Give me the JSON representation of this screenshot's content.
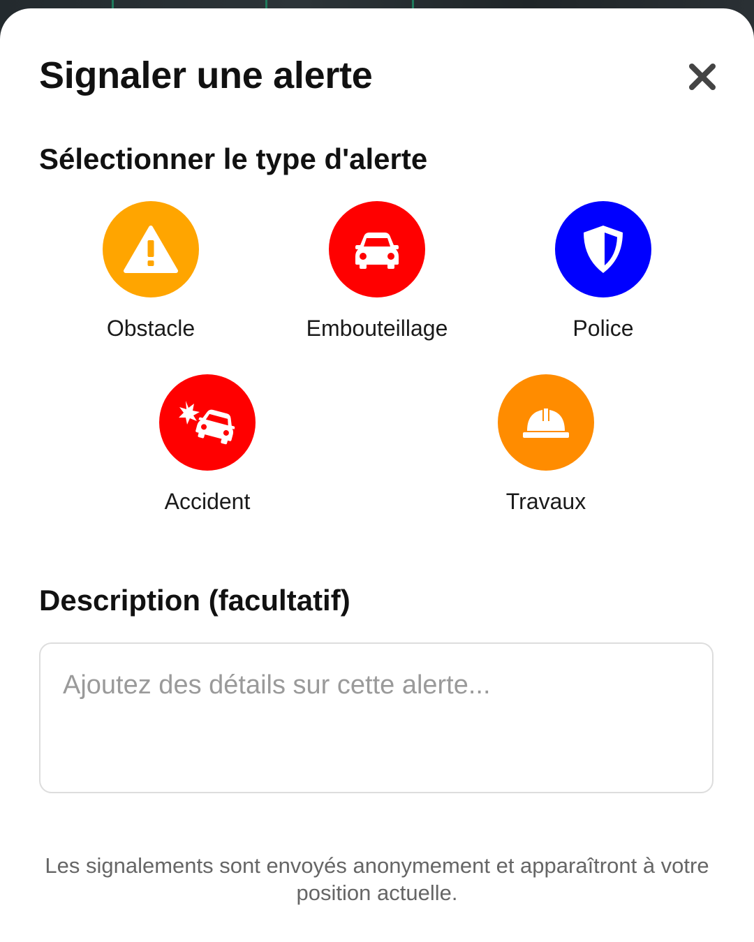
{
  "dialog": {
    "title": "Signaler une alerte",
    "close_icon": "close-icon"
  },
  "alert_types": {
    "heading": "Sélectionner le type d'alerte",
    "options": [
      {
        "label": "Obstacle",
        "icon": "warning-triangle-icon",
        "color": "#FFA500"
      },
      {
        "label": "Embouteillage",
        "icon": "car-icon",
        "color": "#FF0000"
      },
      {
        "label": "Police",
        "icon": "shield-icon",
        "color": "#0000FF"
      },
      {
        "label": "Accident",
        "icon": "car-crash-icon",
        "color": "#FF0000"
      },
      {
        "label": "Travaux",
        "icon": "hard-hat-icon",
        "color": "#FF8C00"
      }
    ]
  },
  "description": {
    "heading": "Description (facultatif)",
    "placeholder": "Ajoutez des détails sur cette alerte...",
    "value": ""
  },
  "footer": {
    "note": "Les signalements sont envoyés anonymement et apparaîtront à votre position actuelle."
  }
}
